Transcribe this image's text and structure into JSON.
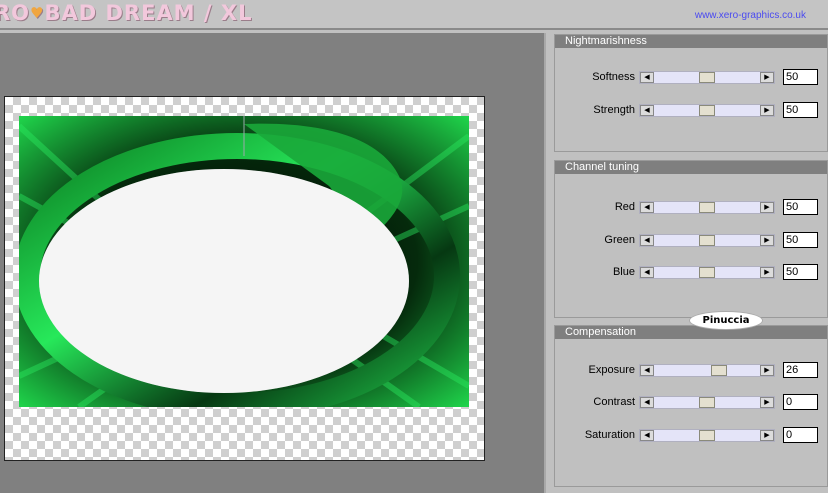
{
  "header": {
    "logo_text": "RO",
    "logo_heart": "♥",
    "logo_text2": "BAD DREAM / XL",
    "site": "www.xero-graphics.co.uk"
  },
  "colors": {
    "accent_green": "#1fd24a",
    "dark_green": "#053a10",
    "panel_bg": "#c0c0c0",
    "title_bar": "#7f7f7f",
    "link": "#4a4af0"
  },
  "groups": {
    "nightmarishness": {
      "title": "Nightmarishness",
      "rows": [
        {
          "label": "Softness",
          "value": "50",
          "level": 0.5
        },
        {
          "label": "Strength",
          "value": "50",
          "level": 0.5
        }
      ]
    },
    "channel": {
      "title": "Channel tuning",
      "rows": [
        {
          "label": "Red",
          "value": "50",
          "level": 0.5
        },
        {
          "label": "Green",
          "value": "50",
          "level": 0.5
        },
        {
          "label": "Blue",
          "value": "50",
          "level": 0.5
        }
      ]
    },
    "compensation": {
      "title": "Compensation",
      "rows": [
        {
          "label": "Exposure",
          "value": "26",
          "level": 0.63
        },
        {
          "label": "Contrast",
          "value": "0",
          "level": 0.5
        },
        {
          "label": "Saturation",
          "value": "0",
          "level": 0.5
        }
      ]
    }
  },
  "badge": "Pinuccia",
  "icons": {
    "left_arrow": "left-arrow-icon",
    "right_arrow": "right-arrow-icon"
  }
}
